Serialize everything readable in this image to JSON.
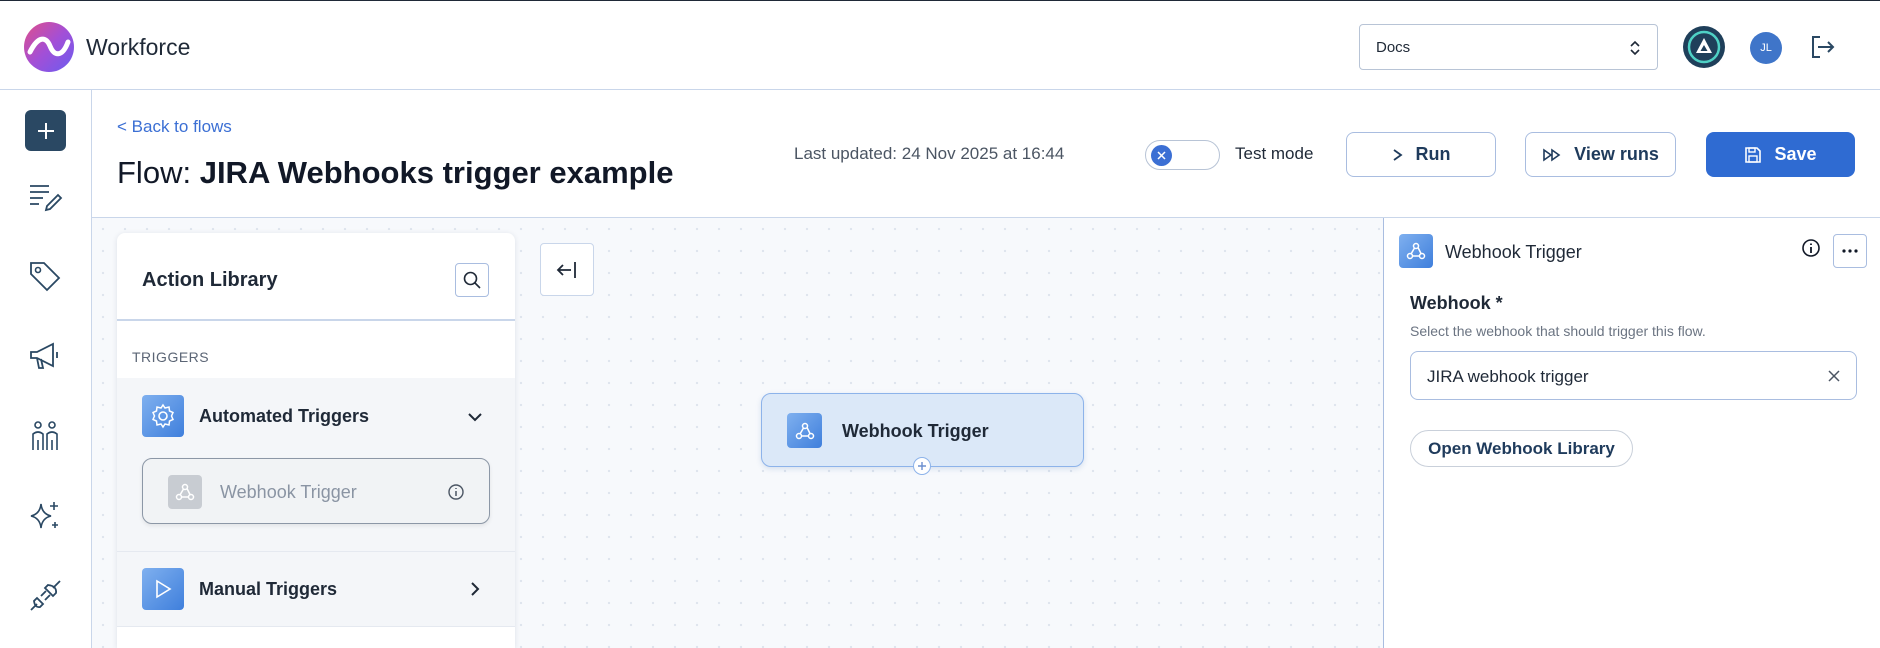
{
  "app": {
    "name": "Workforce"
  },
  "topbar": {
    "workspace_select": "Docs",
    "avatar_initials": "JL"
  },
  "header": {
    "back_link": "< Back to flows",
    "title_prefix": "Flow:",
    "title_name": "JIRA Webhooks trigger example",
    "updated_label": "Last updated:",
    "updated_value": "24 Nov 2025 at 16:44",
    "test_mode_label": "Test mode",
    "test_mode_on": false,
    "run_label": "Run",
    "view_runs_label": "View runs",
    "save_label": "Save"
  },
  "library": {
    "title": "Action Library",
    "section": "TRIGGERS",
    "groups": [
      {
        "label": "Automated Triggers",
        "expanded": true,
        "items": [
          {
            "label": "Webhook Trigger"
          }
        ]
      },
      {
        "label": "Manual Triggers",
        "expanded": false
      }
    ]
  },
  "canvas": {
    "nodes": [
      {
        "label": "Webhook Trigger"
      }
    ]
  },
  "panel": {
    "title": "Webhook Trigger",
    "field_label": "Webhook *",
    "field_help": "Select the webhook that should trigger this flow.",
    "field_value": "JIRA webhook trigger",
    "open_library_label": "Open Webhook Library"
  },
  "colors": {
    "primary": "#2f6bd2",
    "nav_dark": "#2a4863",
    "link": "#3b6fd4",
    "node_bg": "#dbe8f8"
  }
}
